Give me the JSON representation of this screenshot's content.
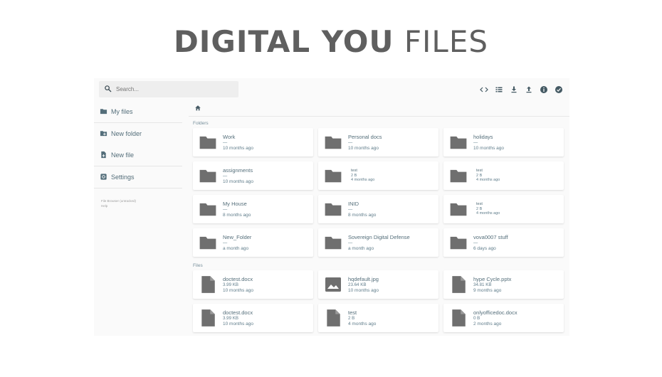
{
  "slide": {
    "title_bold": "DIGITAL YOU",
    "title_light": "FILES"
  },
  "search": {
    "placeholder": "Search..."
  },
  "toolbar": {
    "icons": [
      "code-icon",
      "list-view-icon",
      "download-icon",
      "upload-icon",
      "info-icon",
      "check-circle-icon"
    ]
  },
  "sidebar": {
    "items": [
      {
        "label": "My files",
        "icon": "folder-icon"
      },
      {
        "label": "New folder",
        "icon": "create-folder-icon"
      },
      {
        "label": "New file",
        "icon": "note-add-icon"
      },
      {
        "label": "Settings",
        "icon": "settings-icon"
      }
    ],
    "footer": {
      "line1": "File Browser (untracked)",
      "line2": "Help"
    }
  },
  "breadcrumb": {
    "icon": "home-icon"
  },
  "sections": {
    "folders_label": "Folders",
    "files_label": "Files"
  },
  "folders": [
    {
      "name": "Work",
      "size": "—",
      "modified": "10 months ago"
    },
    {
      "name": "Personal docs",
      "size": "—",
      "modified": "10 months ago"
    },
    {
      "name": "holidays",
      "size": "—",
      "modified": "10 months ago"
    },
    {
      "name": "assignments",
      "size": "—",
      "modified": "10 months ago"
    },
    {
      "name": "test",
      "size": "2 B",
      "modified": "4 months ago",
      "small": true
    },
    {
      "name": "test",
      "size": "2 B",
      "modified": "4 months ago",
      "small": true
    },
    {
      "name": "My House",
      "size": "—",
      "modified": "8 months ago"
    },
    {
      "name": "INID",
      "size": "—",
      "modified": "8 months ago"
    },
    {
      "name": "test",
      "size": "2 B",
      "modified": "4 months ago",
      "small": true
    },
    {
      "name": "New_Folder",
      "size": "—",
      "modified": "a month ago"
    },
    {
      "name": "Sovereign Digital Defense",
      "size": "—",
      "modified": "a month ago"
    },
    {
      "name": "vova0007 stuff",
      "size": "—",
      "modified": "6 days ago"
    }
  ],
  "files": [
    {
      "name": "doctest.docx",
      "size": "3.99 KB",
      "modified": "10 months ago",
      "icon": "file-icon"
    },
    {
      "name": "hqdefault.jpg",
      "size": "23.64 KB",
      "modified": "10 months ago",
      "icon": "image-icon"
    },
    {
      "name": "hype Cycle.pptx",
      "size": "34.81 KB",
      "modified": "9 months ago",
      "icon": "file-icon"
    },
    {
      "name": "doctest.docx",
      "size": "3.99 KB",
      "modified": "10 months ago",
      "icon": "file-icon"
    },
    {
      "name": "test",
      "size": "2 B",
      "modified": "4 months ago",
      "icon": "file-icon"
    },
    {
      "name": "onlyofficedoc.docx",
      "size": "0 B",
      "modified": "2 months ago",
      "icon": "file-icon"
    }
  ],
  "colors": {
    "icon": "#6f6f6f",
    "sidebar_icon": "#546e7a",
    "accent": "#455a64"
  }
}
